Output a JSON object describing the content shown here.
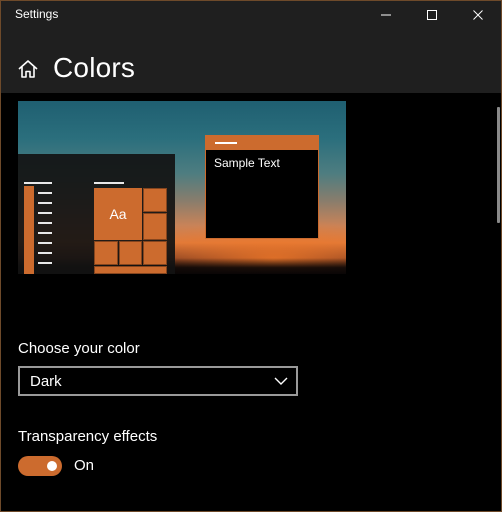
{
  "window": {
    "title": "Settings",
    "controls": {
      "minimize_icon": "minimize-icon",
      "maximize_icon": "maximize-icon",
      "close_icon": "close-icon"
    }
  },
  "header": {
    "home_icon": "home-icon",
    "title": "Colors"
  },
  "preview": {
    "sample_text": "Sample Text",
    "tile_text": "Aa",
    "accent_color": "#cc6b2e"
  },
  "choose_color": {
    "label": "Choose your color",
    "selected": "Dark",
    "chevron_icon": "chevron-down-icon"
  },
  "transparency": {
    "label": "Transparency effects",
    "state_text": "On",
    "enabled": true
  },
  "theme": {
    "background": "#000000",
    "accent": "#cc6b2e",
    "titlebar": "#1f1f1f"
  }
}
